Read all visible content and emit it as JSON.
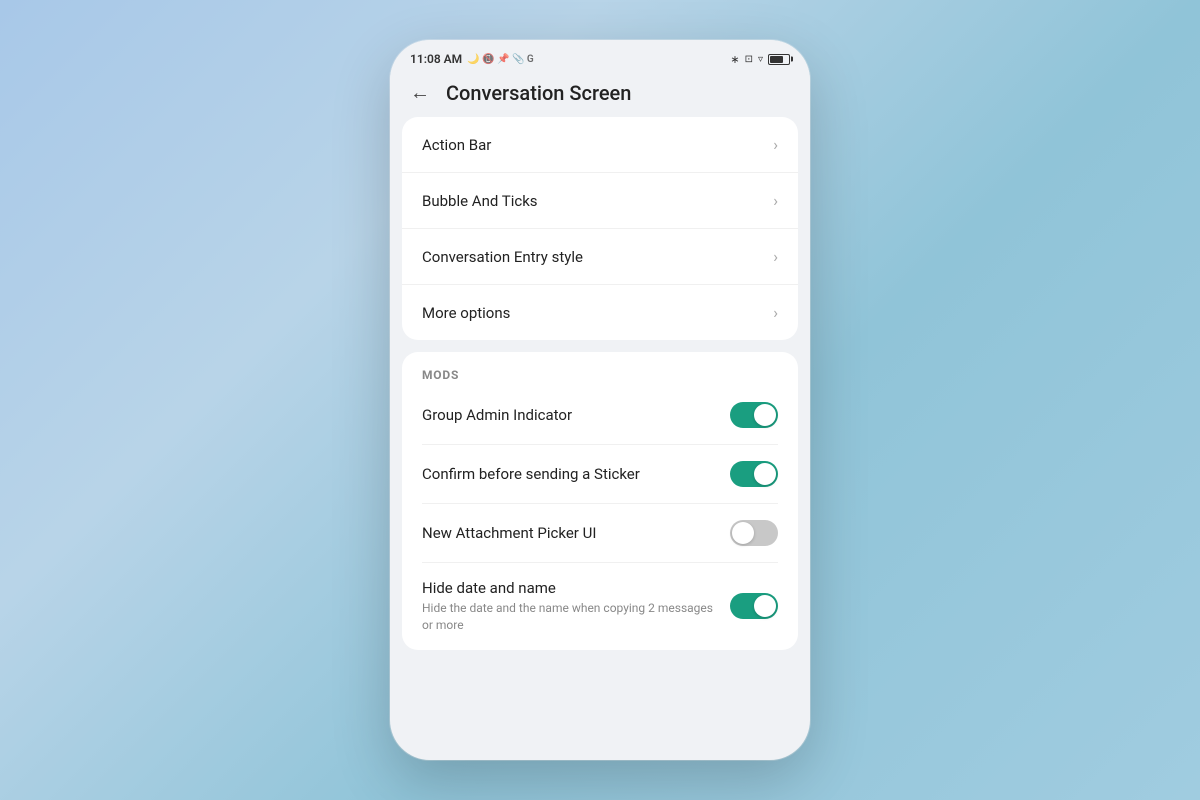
{
  "statusBar": {
    "time": "11:08 AM",
    "icons": [
      "🌙",
      "📵",
      "📌",
      "📎",
      "G"
    ],
    "rightIcons": [
      "BT",
      "📷",
      "WiFi",
      "80"
    ]
  },
  "header": {
    "title": "Conversation Screen",
    "backLabel": "←"
  },
  "menuCard": {
    "items": [
      {
        "id": "action-bar",
        "label": "Action Bar"
      },
      {
        "id": "bubble-ticks",
        "label": "Bubble And Ticks"
      },
      {
        "id": "conversation-entry",
        "label": "Conversation Entry style"
      },
      {
        "id": "more-options",
        "label": "More options"
      }
    ]
  },
  "modsCard": {
    "sectionLabel": "MODS",
    "toggleItems": [
      {
        "id": "group-admin",
        "label": "Group Admin Indicator",
        "sublabel": "",
        "state": "on"
      },
      {
        "id": "confirm-sticker",
        "label": "Confirm before sending a Sticker",
        "sublabel": "",
        "state": "on"
      },
      {
        "id": "attachment-picker",
        "label": "New Attachment Picker UI",
        "sublabel": "",
        "state": "off"
      },
      {
        "id": "hide-date-name",
        "label": "Hide date and name",
        "sublabel": "Hide the date and the name when copying 2 messages or more",
        "state": "on"
      }
    ]
  },
  "colors": {
    "toggleOn": "#1a9e80",
    "toggleOff": "#c8c8c8"
  }
}
